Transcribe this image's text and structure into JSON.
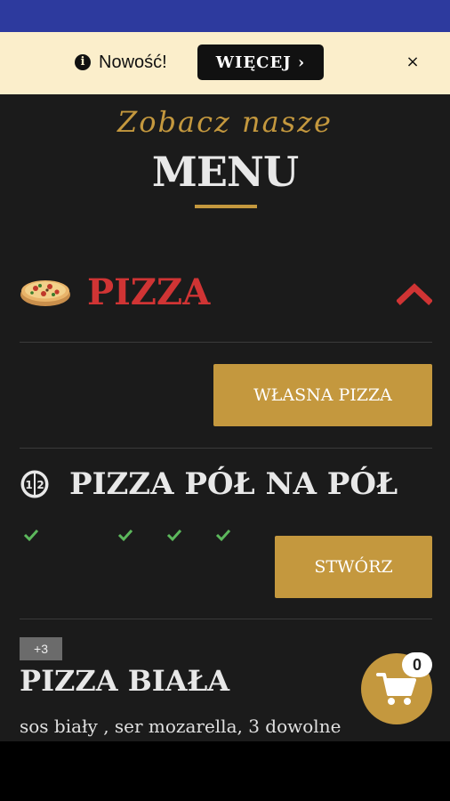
{
  "notice": {
    "text": "Nowość!",
    "button_label": "WIĘCEJ ›",
    "close_label": "×",
    "icon": "info-icon"
  },
  "header": {
    "script_title": "Zobacz nasze",
    "title": "MENU"
  },
  "category": {
    "label": "PIZZA",
    "icon": "pizza-icon",
    "toggle_icon": "chevron-up-icon"
  },
  "own_pizza": {
    "button_label": "WŁASNA PIZZA"
  },
  "half_pizza": {
    "title": "PIZZA PÓŁ NA PÓŁ",
    "icon": "half-and-half-icon",
    "button_label": "STWÓRZ",
    "check_count": 4
  },
  "item": {
    "badge": "+3",
    "title": "PIZZA BIAŁA",
    "description": "sos biały , ser mozarella, 3 dowolne"
  },
  "cart": {
    "count": "0",
    "icon": "cart-icon"
  },
  "colors": {
    "status_bar": "#2d3a9e",
    "notice_bg": "#fbeecb",
    "background": "#1b1b1b",
    "gold": "#c4983e",
    "accent_red": "#d03434",
    "check_green": "#5cb85c"
  }
}
